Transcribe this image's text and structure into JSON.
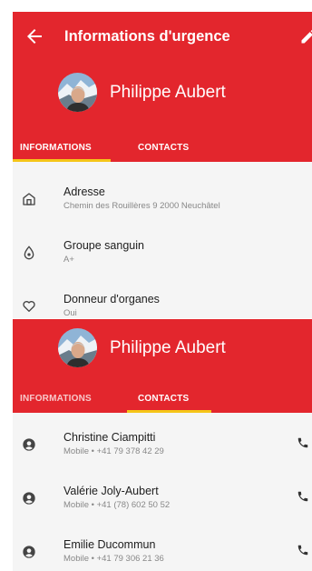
{
  "colors": {
    "primary": "#e3262d",
    "accent": "#f5c518",
    "background": "#f5f5f5"
  },
  "header": {
    "title": "Informations d'urgence",
    "back_icon": "arrow-back-icon",
    "edit_icon": "pencil-icon"
  },
  "profile": {
    "name": "Philippe Aubert"
  },
  "tabs": [
    {
      "label": "INFORMATIONS"
    },
    {
      "label": "CONTACTS"
    }
  ],
  "info_items": [
    {
      "icon": "home-icon",
      "label": "Adresse",
      "value": "Chemin des Rouillères 9 2000 Neuchâtel"
    },
    {
      "icon": "blood-drop-icon",
      "label": "Groupe sanguin",
      "value": "A+"
    },
    {
      "icon": "heart-icon",
      "label": "Donneur d'organes",
      "value": "Oui"
    }
  ],
  "contacts": [
    {
      "name": "Christine Ciampitti",
      "phone": "Mobile • +41 79 378 42 29"
    },
    {
      "name": "Valérie Joly-Aubert",
      "phone": "Mobile • +41 (78) 602 50 52"
    },
    {
      "name": "Emilie Ducommun",
      "phone": "Mobile • +41 79 306 21 36"
    }
  ]
}
